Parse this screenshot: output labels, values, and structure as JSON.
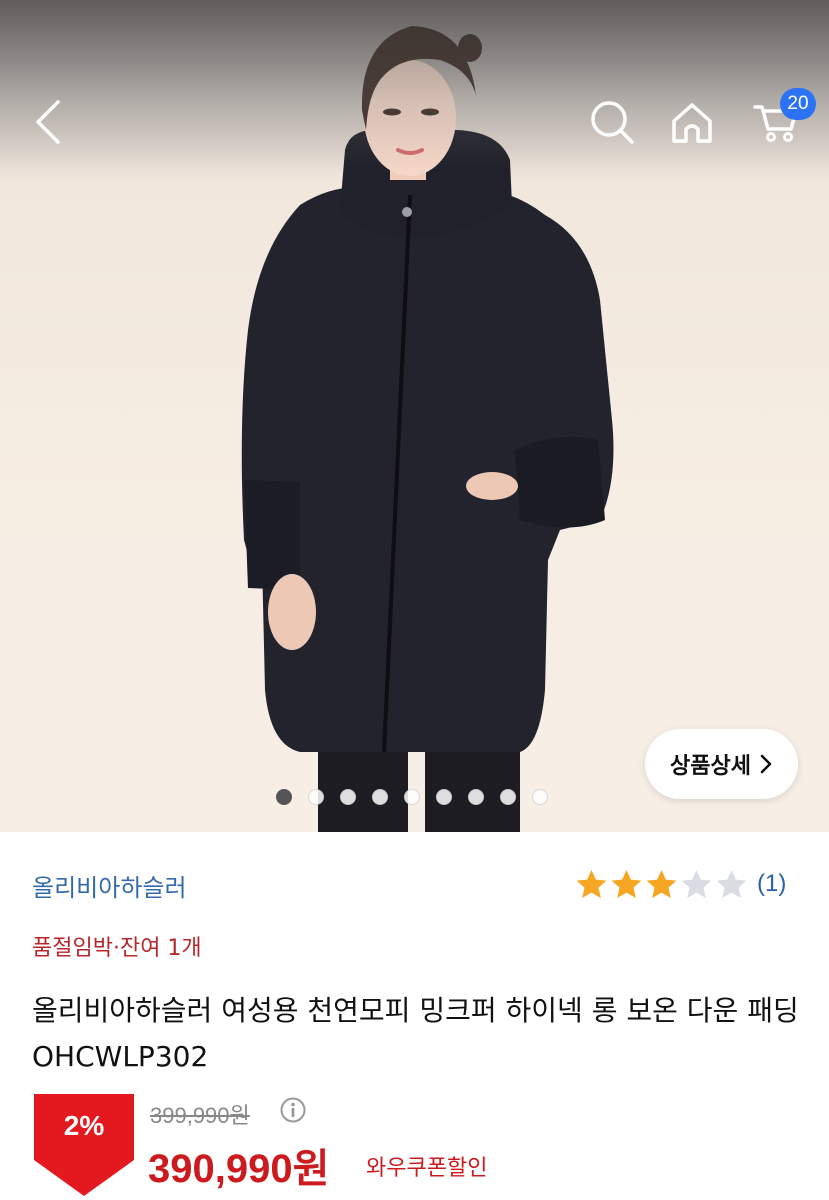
{
  "header": {
    "back_icon": "chevron-left-icon",
    "search_icon": "search-icon",
    "home_icon": "home-icon",
    "cart_icon": "cart-icon",
    "cart_count": "20"
  },
  "gallery": {
    "detail_button_label": "상품상세",
    "detail_button_chevron": "›",
    "total_images": 9,
    "active_index": 0
  },
  "product": {
    "brand": "올리비아하슬러",
    "rating_value": 3,
    "rating_max": 5,
    "review_count": "(1)",
    "stock_notice": "품절임박·잔여 1개",
    "title": "올리비아하슬러 여성용 천연모피 밍크퍼 하이넥 롱 보온 다운 패딩 OHCWLP302",
    "discount_rate": "2%",
    "original_price": "399,990원",
    "sale_price": "390,990원",
    "coupon_label": "와우쿠폰할인"
  },
  "colors": {
    "accent_blue": "#2b72f5",
    "brand_blue": "#346aaa",
    "price_red": "#cc1b1f",
    "star_gold": "#f5a623"
  }
}
